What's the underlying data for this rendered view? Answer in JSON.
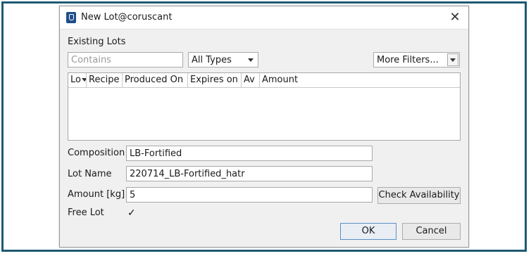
{
  "window": {
    "title": "New Lot@coruscant",
    "close_glyph": "✕"
  },
  "existing_lots": {
    "heading": "Existing Lots",
    "search_placeholder": "Contains",
    "type_filter": "All Types",
    "more_filters": "More Filters...",
    "columns": [
      "Lo",
      "Recipe",
      "Produced On",
      "Expires on",
      "Av",
      "Amount"
    ]
  },
  "form": {
    "composition_label": "Composition",
    "composition_value": "LB-Fortified",
    "lot_name_label": "Lot Name",
    "lot_name_value": "220714_LB-Fortified_hatr",
    "amount_label": "Amount [kg]",
    "amount_value": "5",
    "check_availability_label": "Check Availability",
    "free_lot_label": "Free Lot",
    "free_lot_checked": true,
    "check_glyph": "✓"
  },
  "buttons": {
    "ok": "OK",
    "cancel": "Cancel"
  },
  "colors": {
    "frame_border": "#1d5a73",
    "dialog_background": "#f0f0f0",
    "default_button_border": "#5a8fc6"
  }
}
